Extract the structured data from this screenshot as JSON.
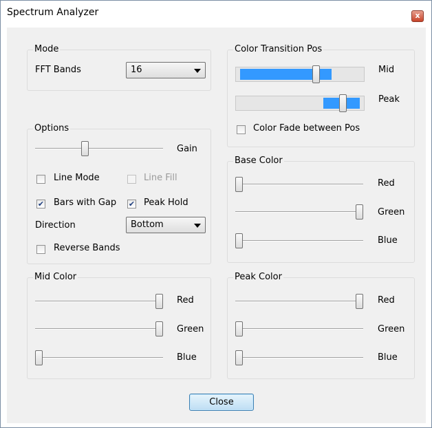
{
  "window": {
    "title": "Spectrum Analyzer",
    "close_glyph": "x"
  },
  "mode": {
    "group_label": "Mode",
    "fft_bands_label": "FFT Bands",
    "fft_bands_value": "16"
  },
  "options": {
    "group_label": "Options",
    "gain_label": "Gain",
    "gain_level": 0.38,
    "line_mode": {
      "label": "Line Mode",
      "checked": false
    },
    "line_fill": {
      "label": "Line Fill",
      "checked": false,
      "enabled": false
    },
    "bars_with_gap": {
      "label": "Bars with Gap",
      "checked": true
    },
    "peak_hold": {
      "label": "Peak Hold",
      "checked": true
    },
    "direction_label": "Direction",
    "direction_value": "Bottom",
    "reverse_bands": {
      "label": "Reverse Bands",
      "checked": false
    }
  },
  "color_transition": {
    "group_label": "Color Transition Pos",
    "mid_label": "Mid",
    "mid_level": 0.64,
    "peak_label": "Peak",
    "peak_level": 0.86,
    "color_fade": {
      "label": "Color Fade between Pos",
      "checked": false
    }
  },
  "base_color": {
    "group_label": "Base Color",
    "red_label": "Red",
    "red": 0.0,
    "green_label": "Green",
    "green": 1.0,
    "blue_label": "Blue",
    "blue": 0.0
  },
  "mid_color": {
    "group_label": "Mid Color",
    "red_label": "Red",
    "red": 1.0,
    "green_label": "Green",
    "green": 1.0,
    "blue_label": "Blue",
    "blue": 0.0
  },
  "peak_color": {
    "group_label": "Peak Color",
    "red_label": "Red",
    "red": 1.0,
    "green_label": "Green",
    "green": 0.0,
    "blue_label": "Blue",
    "blue": 0.0
  },
  "close_button_label": "Close",
  "colors": {
    "accent": "#3399ff",
    "window_border": "#7a8ea3",
    "client_bg": "#f0f0f0"
  },
  "icons": {
    "combo_arrow": "chevron-down-icon",
    "close": "close-icon",
    "check": "checkmark-icon"
  }
}
